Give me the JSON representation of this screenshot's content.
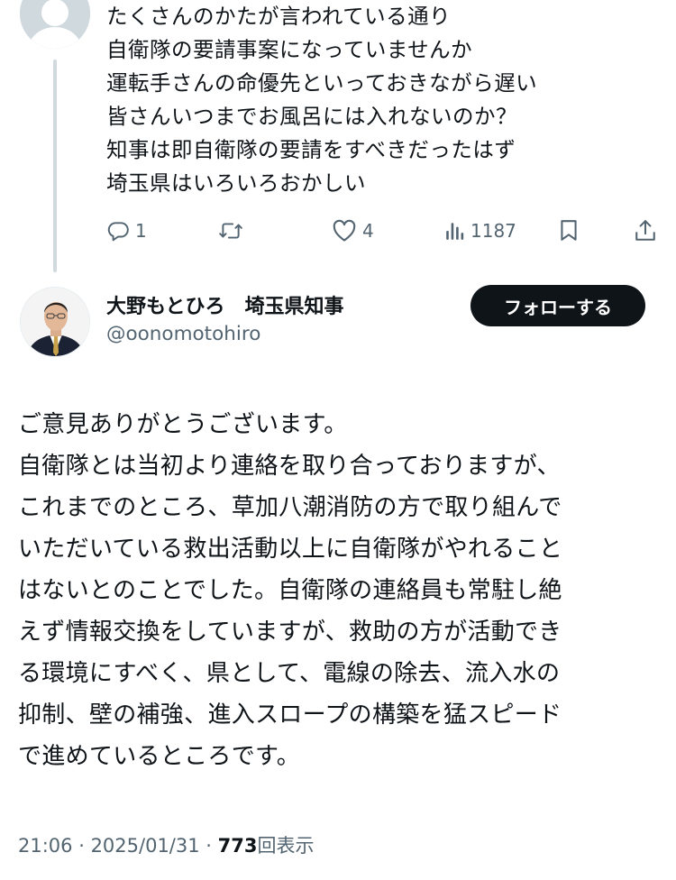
{
  "parent_tweet": {
    "lines": [
      "たくさんのかたが言われている通り",
      "自衛隊の要請事案になっていませんか",
      "運転手さんの命優先といっておきながら遅い",
      "皆さんいつまでお風呂には入れないのか？",
      "知事は即自衛隊の要請をすべきだったはず",
      "埼玉県はいろいろおかしい"
    ],
    "actions": {
      "replies": "1",
      "reposts": "",
      "likes": "4",
      "views": "1187"
    }
  },
  "reply": {
    "author_name": "大野もとひろ　埼玉県知事",
    "handle": "@oonomotohiro",
    "follow_label": "フォローする",
    "lines": [
      "ご意見ありがとうございます。",
      "自衛隊とは当初より連絡を取り合っておりますが、",
      "これまでのところ、草加八潮消防の方で取り組んで",
      "いただいている救出活動以上に自衛隊がやれること",
      "はないとのことでした。自衛隊の連絡員も常駐し絶",
      "えず情報交換をしていますが、救助の方が活動でき",
      "る環境にすべく、県として、電線の除去、流入水の",
      "抑制、壁の補強、進入スロープの構築を猛スピード",
      "で進めているところです。"
    ],
    "meta": {
      "time": "21:06",
      "separator": " · ",
      "date": "2025/01/31",
      "views_count": "773",
      "views_label": "回表示"
    }
  },
  "colors": {
    "text": "#0f1419",
    "secondary": "#536471",
    "thread_line": "#cfd9de",
    "button_bg": "#0f1419"
  },
  "icons": [
    "default-avatar-icon",
    "reply-icon",
    "repost-icon",
    "like-icon",
    "views-icon",
    "bookmark-icon",
    "share-icon"
  ]
}
